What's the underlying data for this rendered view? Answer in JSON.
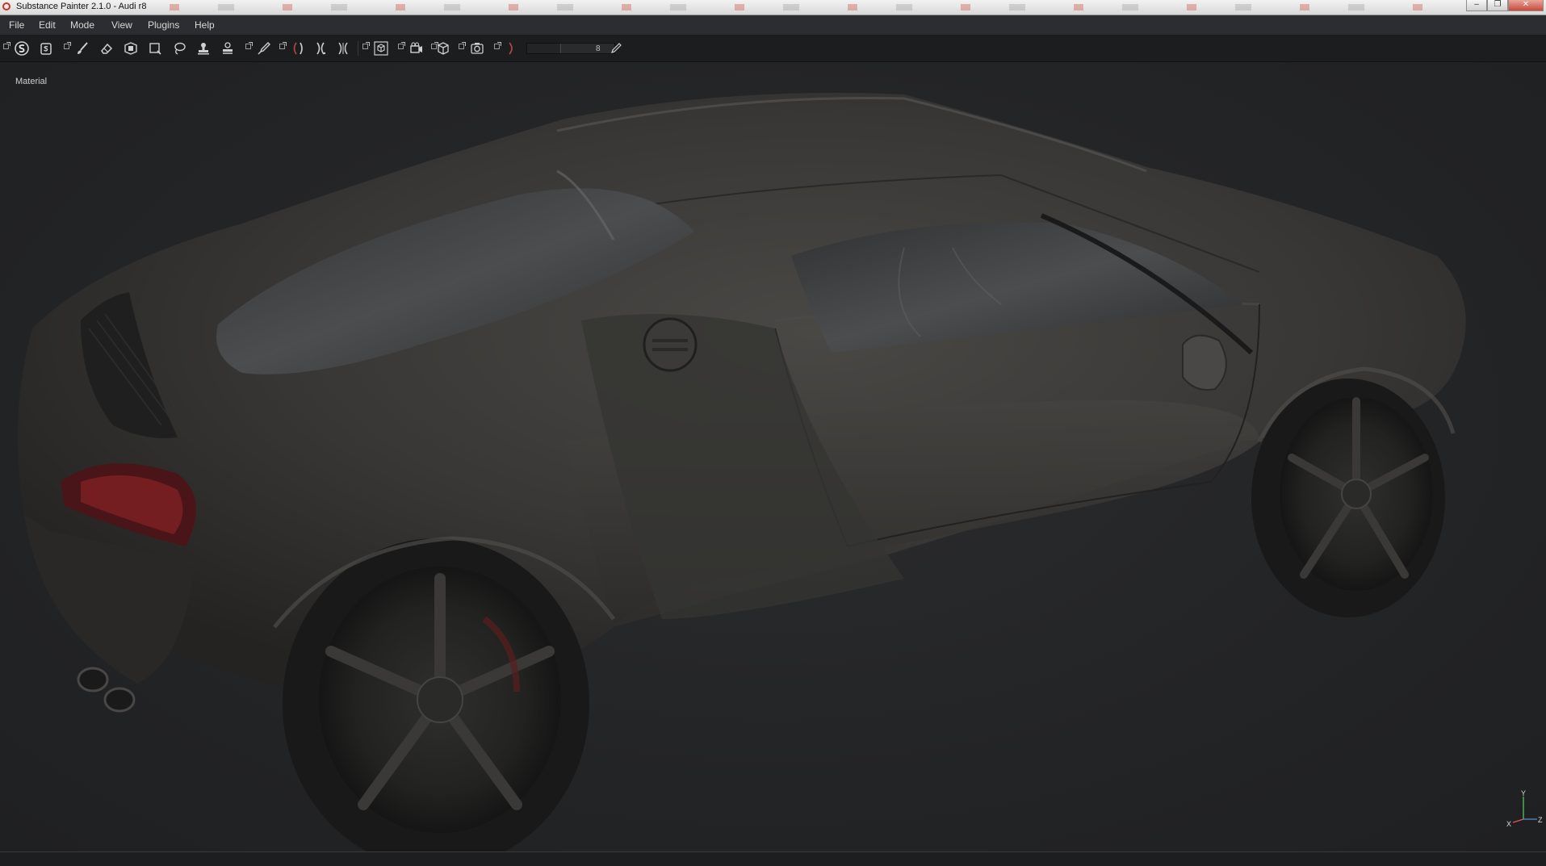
{
  "window": {
    "title": "Substance Painter 2.1.0 - Audi r8",
    "controls": {
      "minimize": "–",
      "maximize": "❐",
      "close": "✕"
    }
  },
  "menubar": {
    "items": [
      "File",
      "Edit",
      "Mode",
      "View",
      "Plugins",
      "Help"
    ]
  },
  "toolbar": {
    "tools": [
      "substance-logo-icon",
      "smart-material-icon",
      "paint-brush-icon",
      "eraser-icon",
      "projection-icon",
      "polygon-fill-icon",
      "lasso-icon",
      "clone-stamp-icon",
      "smudge-icon",
      "color-picker-icon",
      "symmetry-left-icon",
      "symmetry-right-icon",
      "symmetry-mirror-icon",
      "3d-view-icon",
      "camera-icon",
      "2d-3d-cube-icon",
      "screenshot-icon",
      "bracket-icon"
    ],
    "slider_value": "8",
    "slider_fraction": 0.37
  },
  "viewport": {
    "label": "Material",
    "axis": {
      "y": "Y",
      "x": "X",
      "z": "Z"
    },
    "colors": {
      "background": "#232426",
      "car_body": "#3a3937",
      "accent_taillight": "#7a1f22"
    }
  }
}
